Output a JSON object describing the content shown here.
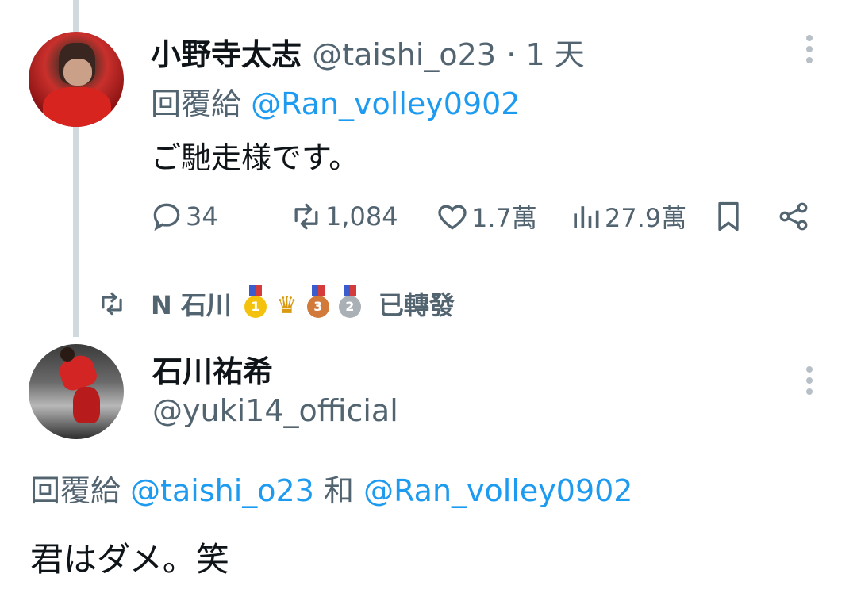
{
  "tweet1": {
    "display_name": "小野寺太志",
    "handle": "@taishi_o23",
    "time": "· 1 天",
    "reply_prefix": "回覆給",
    "reply_to": "@Ran_volley0902",
    "text": "ご馳走様です。",
    "stats": {
      "replies": "34",
      "retweets": "1,084",
      "likes": "1.7萬",
      "views": "27.9萬"
    }
  },
  "retweet_banner": {
    "name": "N 石川",
    "trophy_icons": [
      "gold-medal-icon",
      "trophy-icon",
      "bronze-medal-icon",
      "silver-medal-icon"
    ],
    "medal_numbers": [
      "1",
      "3",
      "2"
    ],
    "suffix": "已轉發"
  },
  "tweet2": {
    "display_name": "石川祐希",
    "handle": "@yuki14_official",
    "reply_prefix": "回覆給",
    "reply_to_1": "@taishi_o23",
    "conjunction": "和",
    "reply_to_2": "@Ran_volley0902",
    "text": "君はダメ。笑"
  },
  "colors": {
    "link": "#1d9bf0",
    "secondary_text": "#536471",
    "primary_text": "#0f1419",
    "thread_line": "#cfd9de"
  }
}
